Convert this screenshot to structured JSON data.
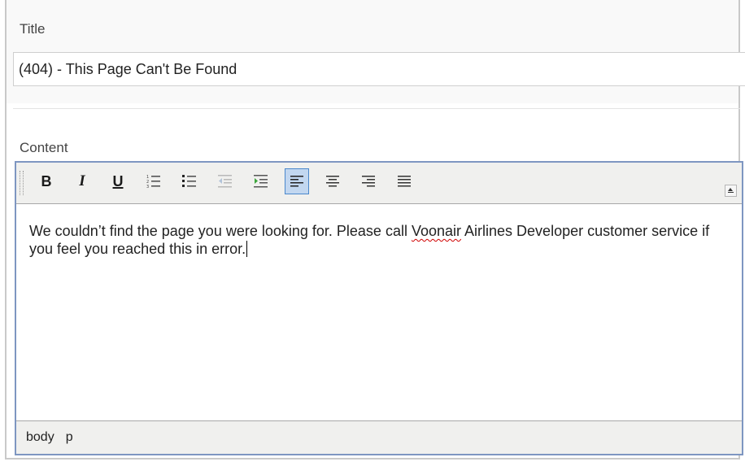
{
  "form": {
    "title_label": "Title",
    "title_value": "(404) - This Page Can't Be Found",
    "content_label": "Content"
  },
  "editor": {
    "toolbar": [
      {
        "name": "bold-button",
        "label": "B"
      },
      {
        "name": "italic-button",
        "label": "I"
      },
      {
        "name": "underline-button",
        "label": "U"
      },
      {
        "name": "ordered-list-button",
        "icon": "ordered-list-icon"
      },
      {
        "name": "unordered-list-button",
        "icon": "unordered-list-icon"
      },
      {
        "name": "outdent-button",
        "icon": "outdent-icon",
        "disabled": true
      },
      {
        "name": "indent-button",
        "icon": "indent-icon"
      },
      {
        "name": "align-left-button",
        "icon": "align-left-icon",
        "active": true
      },
      {
        "name": "align-center-button",
        "icon": "align-center-icon"
      },
      {
        "name": "align-right-button",
        "icon": "align-right-icon"
      },
      {
        "name": "align-justify-button",
        "icon": "align-justify-icon"
      }
    ],
    "content": {
      "text_before": "We couldn’t find the page you were looking for. Please call ",
      "misspelled": "Voonair",
      "text_after": " Airlines Developer customer service if you feel you reached this in error."
    },
    "path": [
      "body",
      "p"
    ]
  },
  "colors": {
    "editor_border": "#7e96c1",
    "toolbar_bg": "#f0f0ee",
    "active_button_bg": "#c2d7f0",
    "active_button_border": "#4b88cc",
    "spellcheck": "#d00000"
  }
}
